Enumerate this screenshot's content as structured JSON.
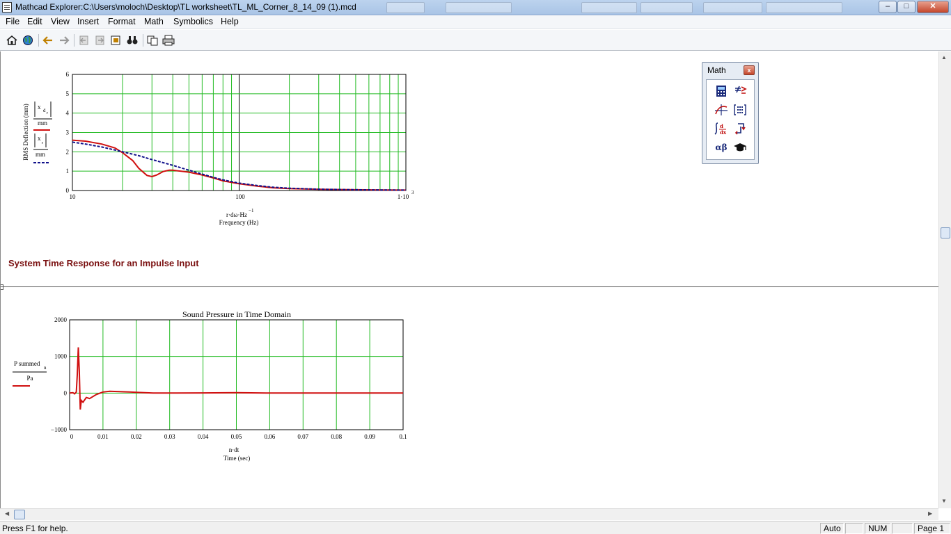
{
  "window": {
    "title": "Mathcad Explorer:C:\\Users\\moloch\\Desktop\\TL worksheet\\TL_ML_Corner_8_14_09 (1).mcd",
    "controls": {
      "minimize": "–",
      "maximize": "□",
      "close": "✕"
    }
  },
  "menu": [
    "File",
    "Edit",
    "View",
    "Insert",
    "Format",
    "Math",
    "Symbolics",
    "Help"
  ],
  "toolbar": [
    "home-icon",
    "globe-icon",
    "back-icon",
    "forward-icon",
    "collection-prev-icon",
    "collection-next-icon",
    "open-icon",
    "find-icon",
    "copy-icon",
    "print-icon"
  ],
  "palette": {
    "title": "Math",
    "close": "x",
    "buttons": [
      "calculator-icon",
      "evaluation-icon",
      "graph-icon",
      "matrix-icon",
      "calculus-icon",
      "programming-icon",
      "greek-icon",
      "symbolic-icon"
    ],
    "greek_label": "αβ"
  },
  "plot1": {
    "ylabel": "RMS Deflection (mm)",
    "legend": [
      {
        "expr": "|x_dr|",
        "unit": "mm",
        "color": "#d01010",
        "style": "solid"
      },
      {
        "expr": "|x_r|",
        "unit": "mm",
        "color": "#10108a",
        "style": "dashed"
      }
    ],
    "xexpr": "r·dω·Hz",
    "xexpr_sup": "−1",
    "xlabel": "Frequency (Hz)",
    "xticks": [
      "10",
      "100",
      "1·10"
    ],
    "xtick_last_sup": "3",
    "yticks": [
      "0",
      "1",
      "2",
      "3",
      "4",
      "5",
      "6"
    ]
  },
  "heading": "System Time Response for an Impulse Input",
  "plot2": {
    "title": "Sound Pressure in Time Domain",
    "legend": {
      "expr": "P summed",
      "sub": "n",
      "unit": "Pa",
      "color": "#d01010"
    },
    "xexpr": "n·dt",
    "xlabel": "Time (sec)",
    "xticks": [
      "0",
      "0.01",
      "0.02",
      "0.03",
      "0.04",
      "0.05",
      "0.06",
      "0.07",
      "0.08",
      "0.09",
      "0.1"
    ],
    "yticks": [
      "2000",
      "1000",
      "0",
      "−1000"
    ]
  },
  "chart_data": [
    {
      "type": "line",
      "xscale": "log",
      "xlim": [
        10,
        1000
      ],
      "ylim": [
        0,
        6
      ],
      "ylabel": "RMS Deflection (mm)",
      "xlabel": "Frequency (Hz)",
      "grid": true,
      "series": [
        {
          "name": "|x_dr| / mm",
          "color": "#d01010",
          "x": [
            10,
            12,
            15,
            18,
            20,
            23,
            25,
            28,
            30,
            32,
            35,
            38,
            40,
            45,
            50,
            60,
            70,
            80,
            100,
            130,
            160,
            200,
            300,
            500,
            700,
            1000
          ],
          "y": [
            2.6,
            2.55,
            2.4,
            2.2,
            1.95,
            1.55,
            1.15,
            0.78,
            0.72,
            0.8,
            0.98,
            1.05,
            1.05,
            1.0,
            0.95,
            0.8,
            0.65,
            0.5,
            0.35,
            0.22,
            0.14,
            0.1,
            0.06,
            0.04,
            0.03,
            0.02
          ]
        },
        {
          "name": "|x_r| / mm",
          "color": "#10108a",
          "x": [
            10,
            12,
            15,
            20,
            25,
            30,
            40,
            50,
            60,
            70,
            80,
            100,
            130,
            160,
            200,
            300,
            500,
            700,
            1000
          ],
          "y": [
            2.5,
            2.4,
            2.25,
            2.0,
            1.8,
            1.6,
            1.3,
            1.05,
            0.85,
            0.68,
            0.55,
            0.38,
            0.25,
            0.17,
            0.12,
            0.07,
            0.04,
            0.03,
            0.02
          ]
        }
      ]
    },
    {
      "type": "line",
      "title": "Sound Pressure in Time Domain",
      "xlim": [
        0,
        0.1
      ],
      "ylim": [
        -1000,
        2000
      ],
      "xlabel": "Time (sec)",
      "grid": true,
      "series": [
        {
          "name": "P summed_n / Pa",
          "color": "#d01010",
          "x": [
            0,
            0.001,
            0.0015,
            0.002,
            0.0023,
            0.0026,
            0.0029,
            0.0032,
            0.0035,
            0.004,
            0.005,
            0.006,
            0.008,
            0.01,
            0.012,
            0.015,
            0.018,
            0.02,
            0.025,
            0.04,
            0.05,
            0.06,
            0.1
          ],
          "y": [
            0,
            10,
            -20,
            30,
            500,
            1250,
            600,
            -450,
            -200,
            -250,
            -120,
            -150,
            -40,
            30,
            50,
            40,
            30,
            20,
            0,
            5,
            10,
            0,
            0
          ]
        }
      ]
    }
  ],
  "status": {
    "help": "Press F1 for help.",
    "mode": "Auto",
    "num": "NUM",
    "page": "Page 1"
  }
}
